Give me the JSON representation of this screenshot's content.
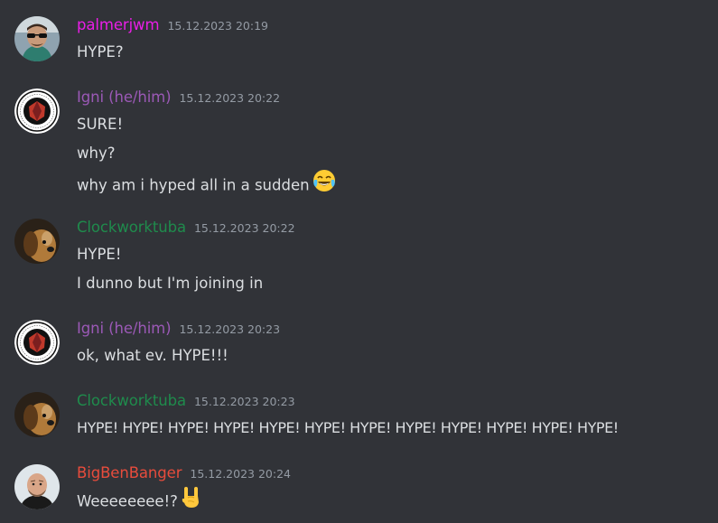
{
  "messages": [
    {
      "author": "palmerjwm",
      "author_color": "#e91ee6",
      "timestamp": "15.12.2023 20:19",
      "avatar": "avatar-sunglasses",
      "lines": [
        "HYPE?"
      ]
    },
    {
      "author": "Igni (he/him)",
      "author_color": "#9b59b6",
      "timestamp": "15.12.2023 20:22",
      "avatar": "avatar-emblem",
      "lines": [
        "SURE!",
        "why?",
        "why am i hyped all in a sudden"
      ],
      "emoji": "joy-emoji"
    },
    {
      "author": "Clockworktuba",
      "author_color": "#1f8b4c",
      "timestamp": "15.12.2023 20:22",
      "avatar": "avatar-dog",
      "lines": [
        "HYPE!",
        "I dunno but I'm joining in"
      ]
    },
    {
      "author": "Igni (he/him)",
      "author_color": "#9b59b6",
      "timestamp": "15.12.2023 20:23",
      "avatar": "avatar-emblem",
      "lines": [
        "ok, what ev. HYPE!!!"
      ]
    },
    {
      "author": "Clockworktuba",
      "author_color": "#1f8b4c",
      "timestamp": "15.12.2023 20:23",
      "avatar": "avatar-dog",
      "lines": [
        "HYPE! HYPE! HYPE! HYPE! HYPE! HYPE! HYPE! HYPE! HYPE! HYPE! HYPE! HYPE!"
      ]
    },
    {
      "author": "BigBenBanger",
      "author_color": "#e74c3c",
      "timestamp": "15.12.2023 20:24",
      "avatar": "avatar-bald",
      "lines": [
        "Weeeeeeee!?"
      ],
      "emoji": "rock-on-emoji"
    }
  ]
}
